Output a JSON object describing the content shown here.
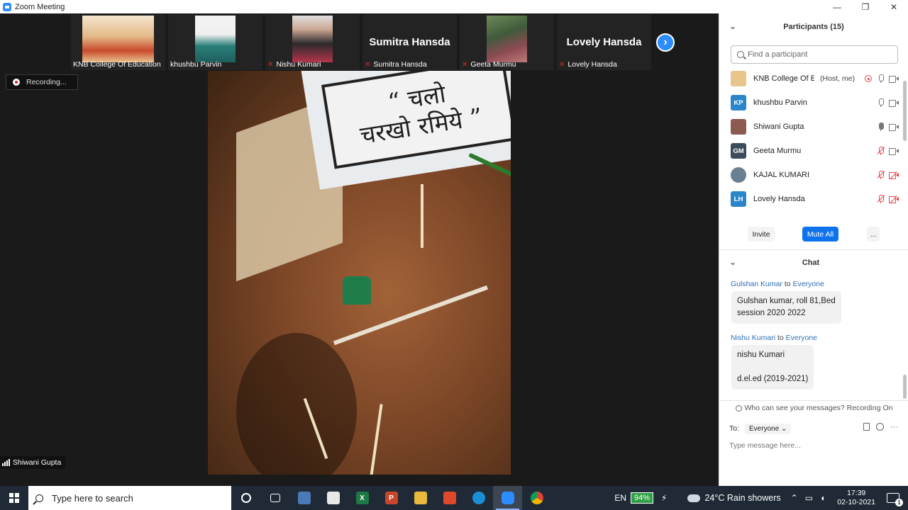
{
  "window": {
    "title": "Zoom Meeting",
    "controls": {
      "minimize": "—",
      "maximize": "❐",
      "close": "✕"
    }
  },
  "gallery": {
    "tiles": [
      {
        "label": "KNB College Of Education",
        "muted": false,
        "has_video": true
      },
      {
        "label": "khushbu Parvin",
        "muted": false,
        "has_video": true
      },
      {
        "label": "Nishu Kumari",
        "muted": true,
        "has_video": true
      },
      {
        "label": "Sumitra Hansda",
        "display_name": "Sumitra Hansda",
        "muted": true,
        "has_video": false
      },
      {
        "label": "Geeta Murmu",
        "muted": true,
        "has_video": true
      },
      {
        "label": "Lovely Hansda",
        "display_name": "Lovely Hansda",
        "muted": true,
        "has_video": false
      }
    ],
    "next_icon": "chevron-right-icon",
    "next_glyph": "›"
  },
  "recording": {
    "label": "Recording..."
  },
  "main_video": {
    "speaker_label": "Shiwani Gupta",
    "sign_line1": "“ चलो",
    "sign_line2": "चरखो रमिये ”"
  },
  "participants": {
    "header": "Participants (15)",
    "search_placeholder": "Find a participant",
    "list": [
      {
        "initials": "",
        "name": "KNB College Of E...",
        "tag": "(Host, me)",
        "avatar_color": "#d9a441",
        "mic": "on",
        "cam": "on",
        "recording": true
      },
      {
        "initials": "KP",
        "name": "khushbu Parvin",
        "tag": "",
        "avatar_color": "#2b86c9",
        "mic": "on",
        "cam": "on",
        "recording": false
      },
      {
        "initials": "",
        "name": "Shiwani Gupta",
        "tag": "",
        "avatar_color": "#8c5a50",
        "mic": "active",
        "cam": "on",
        "recording": false
      },
      {
        "initials": "GM",
        "name": "Geeta Murmu",
        "tag": "",
        "avatar_color": "#3b4b5a",
        "mic": "muted",
        "cam": "on",
        "recording": false
      },
      {
        "initials": "",
        "name": "KAJAL KUMARI",
        "tag": "",
        "avatar_color": "#6a7f8f",
        "mic": "muted",
        "cam": "muted",
        "recording": false
      },
      {
        "initials": "LH",
        "name": "Lovely Hansda",
        "tag": "",
        "avatar_color": "#2b86c9",
        "mic": "muted",
        "cam": "muted",
        "recording": false
      }
    ],
    "buttons": {
      "invite": "Invite",
      "mute_all": "Mute All",
      "more": "..."
    }
  },
  "chat": {
    "header": "Chat",
    "messages": [
      {
        "from": "Gulshan Kumar",
        "to_word": "to",
        "to": "Everyone",
        "lines": [
          "Gulshan kumar, roll 81,Bed",
          "session 2020 2022"
        ]
      },
      {
        "from": "Nishu Kumari",
        "to_word": "to",
        "to": "Everyone",
        "lines": [
          "nishu Kumari",
          "",
          "d.el.ed  (2019-2021)"
        ]
      }
    ],
    "who_can_see": "Who can see your messages? Recording On",
    "to_label": "To:",
    "to_value": "Everyone",
    "input_placeholder": "Type message here...",
    "more": "···"
  },
  "taskbar": {
    "search_placeholder": "Type here to search",
    "language": "EN",
    "battery": "94%",
    "weather": "24°C  Rain showers",
    "time": "17:39",
    "date": "02-10-2021",
    "notification_count": "1"
  }
}
